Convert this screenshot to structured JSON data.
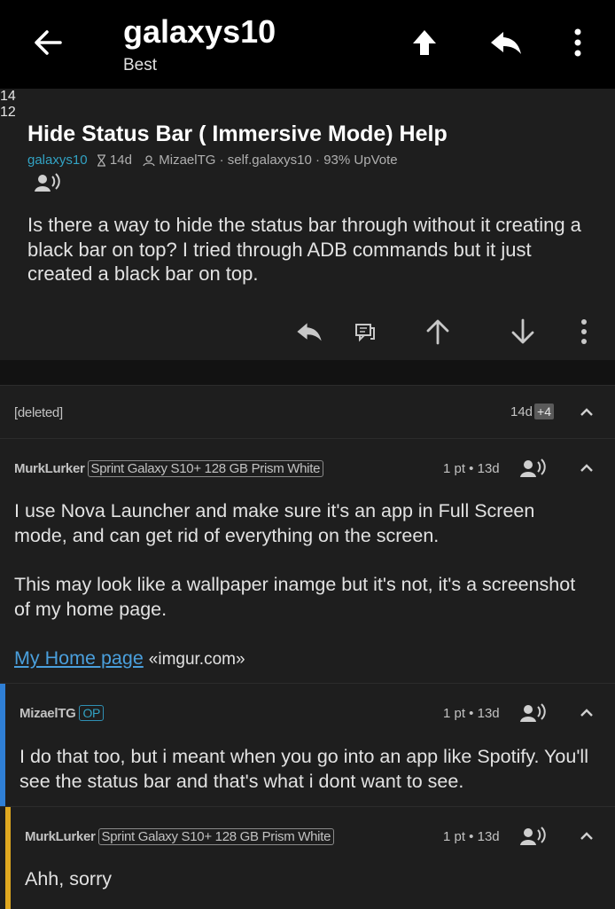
{
  "appbar": {
    "title": "galaxys10",
    "sort": "Best",
    "icons": [
      "back-arrow-icon",
      "upvote-icon",
      "reply-icon",
      "more-vertical-icon"
    ]
  },
  "post": {
    "title": "Hide Status Bar ( Immersive Mode) Help",
    "subreddit": "galaxys10",
    "age": "14d",
    "author": "MizaelTG",
    "domain": "self.galaxys10",
    "upvote_ratio": "93% UpVote",
    "body": "Is there a way to hide the status bar through without it creating a black bar on top? I tried through ADB commands but it just created a black bar on top.",
    "comments_count": "14",
    "score": "12"
  },
  "comments": [
    {
      "author": "[deleted]",
      "age": "14d",
      "hidden_count": "+4"
    },
    {
      "author": "MurkLurker",
      "flair": "Sprint Galaxy S10+ 128 GB Prism White",
      "stats": "1 pt • 13d",
      "body_p1": "I use Nova Launcher and make sure it's an app in Full Screen mode, and can get rid of everything on the screen.",
      "body_p2": "This may look like a wallpaper inamge but it's not, it's a screenshot of my home page.",
      "link_text": "My Home page",
      "link_domain": "«imgur.com»"
    },
    {
      "author": "MizaelTG",
      "op_badge": "OP",
      "stats": "1 pt • 13d",
      "body": "I do that too, but i meant when you go into an app like Spotify. You'll see the status bar and that's what i dont want to see.",
      "bar_color": "#2f7fd6"
    },
    {
      "author": "MurkLurker",
      "flair": "Sprint Galaxy S10+ 128 GB Prism White",
      "stats": "1 pt • 13d",
      "body": "Ahh, sorry",
      "bar_color": "#e0a820"
    }
  ],
  "colors": {
    "accent": "#32a3c4",
    "background": "#121212",
    "card": "#1e1e1e",
    "appbar": "#000000"
  }
}
